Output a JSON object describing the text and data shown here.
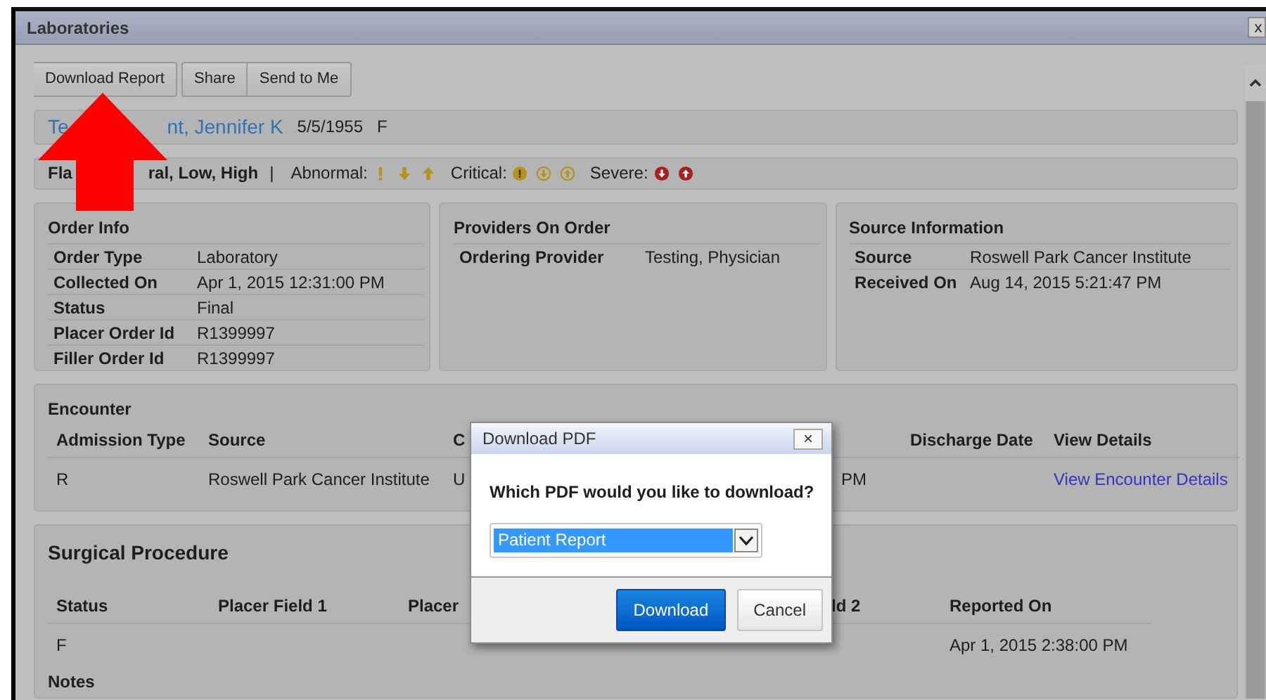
{
  "window": {
    "title": "Laboratories",
    "close": "x"
  },
  "button_groups": [
    [
      "Download Report"
    ],
    [
      "Share",
      "Send to Me"
    ]
  ],
  "patient": {
    "name_parts": [
      "Te",
      "nt, Jennifer K"
    ],
    "dob": "5/5/1955",
    "sex": "F"
  },
  "legend": {
    "label_parts": [
      "Fla",
      "ral, Low, High"
    ],
    "separator": "|",
    "groups": [
      {
        "label": "Abnormal:",
        "color": "#b8921a",
        "icons": [
          {
            "kind": "bang",
            "filled": false
          },
          {
            "kind": "down",
            "filled": false
          },
          {
            "kind": "up",
            "filled": false
          }
        ]
      },
      {
        "label": "Critical:",
        "color": "#b8921a",
        "icons": [
          {
            "kind": "bang",
            "filled": true
          },
          {
            "kind": "down",
            "filled": false
          },
          {
            "kind": "up",
            "filled": false
          }
        ]
      },
      {
        "label": "Severe:",
        "color": "#a82020",
        "icons": [
          {
            "kind": "down",
            "filled": true
          },
          {
            "kind": "up",
            "filled": true
          }
        ]
      }
    ]
  },
  "panels": [
    {
      "title": "Order Info",
      "rows": [
        {
          "label": "Order Type",
          "value": "Laboratory"
        },
        {
          "label": "Collected On",
          "value": "Apr 1, 2015 12:31:00 PM"
        },
        {
          "label": "Status",
          "value": "Final"
        },
        {
          "label": "Placer Order Id",
          "value": "R1399997"
        },
        {
          "label": "Filler Order Id",
          "value": "R1399997"
        }
      ]
    },
    {
      "title": "Providers On Order",
      "rows": [
        {
          "label": "Ordering Provider",
          "value": "Testing, Physician"
        }
      ]
    },
    {
      "title": "Source Information",
      "rows": [
        {
          "label": "Source",
          "value": "Roswell Park Cancer Institute"
        },
        {
          "label": "Received On",
          "value": "Aug 14, 2015 5:21:47 PM"
        }
      ]
    }
  ],
  "encounter": {
    "title": "Encounter",
    "columns": [
      {
        "header": "Admission Type",
        "cells": [
          {
            "text": "R",
            "kind": "text"
          }
        ]
      },
      {
        "header": "Source",
        "cells": [
          {
            "text": "Roswell Park Cancer Institute",
            "kind": "text"
          }
        ]
      },
      {
        "header": "C",
        "cells": [
          {
            "text": "U",
            "kind": "text"
          }
        ]
      },
      {
        "cells": [
          {
            "text": "PM",
            "kind": "text"
          }
        ]
      },
      {
        "header": "Discharge Date"
      },
      {
        "header": "View Details",
        "cells": [
          {
            "text": "View Encounter Details",
            "kind": "link"
          }
        ]
      }
    ]
  },
  "surgical": {
    "title": "Surgical Procedure",
    "columns": [
      {
        "header": "Status",
        "cells": [
          "F"
        ]
      },
      {
        "header": "Placer Field 1"
      },
      {
        "header": "Placer"
      },
      {
        "header": "ld 2"
      },
      {
        "header": "Reported On",
        "cells": [
          "Apr 1, 2015 2:38:00 PM"
        ]
      }
    ],
    "notes_title": "Notes"
  },
  "dialog": {
    "title": "Download PDF",
    "close": "×",
    "question": "Which PDF would you like to download?",
    "select": {
      "value": "Patient Report"
    },
    "buttons": [
      {
        "label": "Download",
        "kind": "primary"
      },
      {
        "label": "Cancel",
        "kind": "secondary"
      }
    ]
  }
}
